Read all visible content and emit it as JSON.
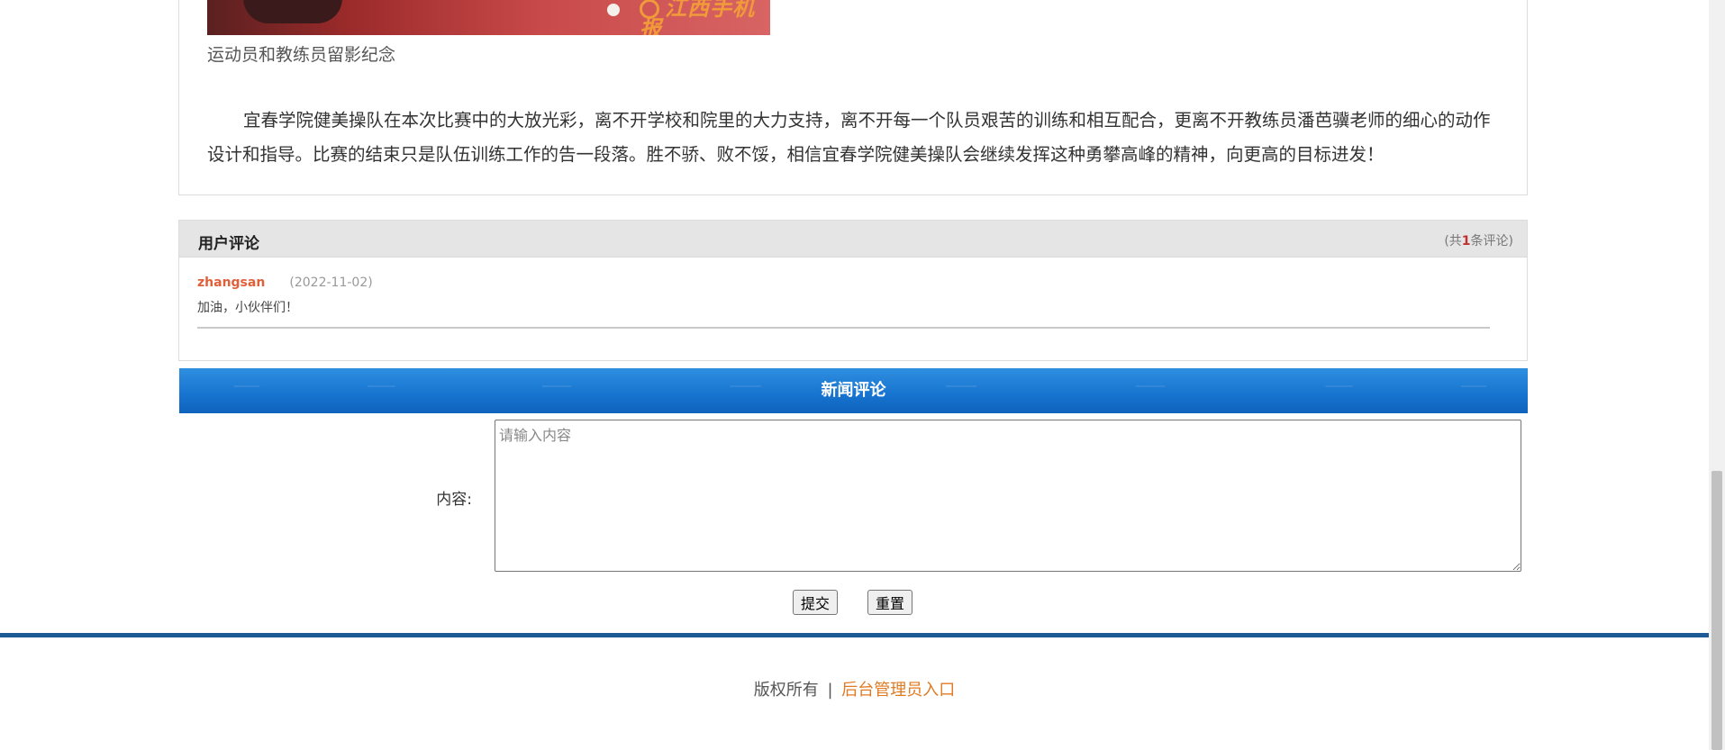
{
  "article": {
    "image_watermark": "江西手机报",
    "caption": "运动员和教练员留影纪念",
    "paragraph": "宜春学院健美操队在本次比赛中的大放光彩，离不开学校和院里的大力支持，离不开每一个队员艰苦的训练和相互配合，更离不开教练员潘芭骥老师的细心的动作设计和指导。比赛的结束只是队伍训练工作的告一段落。胜不骄、败不馁，相信宜春学院健美操队会继续发挥这种勇攀高峰的精神，向更高的目标进发！"
  },
  "comments": {
    "title": "用户评论",
    "count_prefix": "(共",
    "count": "1",
    "count_suffix": "条评论)",
    "items": [
      {
        "user": "zhangsan",
        "date": "(2022-11-02)",
        "text": "加油，小伙伴们！"
      }
    ]
  },
  "news_comment": {
    "banner_title": "新闻评论",
    "content_label": "内容:",
    "content_placeholder": "请输入内容",
    "submit_label": "提交",
    "reset_label": "重置"
  },
  "footer": {
    "copyright": "版权所有",
    "separator": "|",
    "admin_link": "后台管理员入口"
  }
}
